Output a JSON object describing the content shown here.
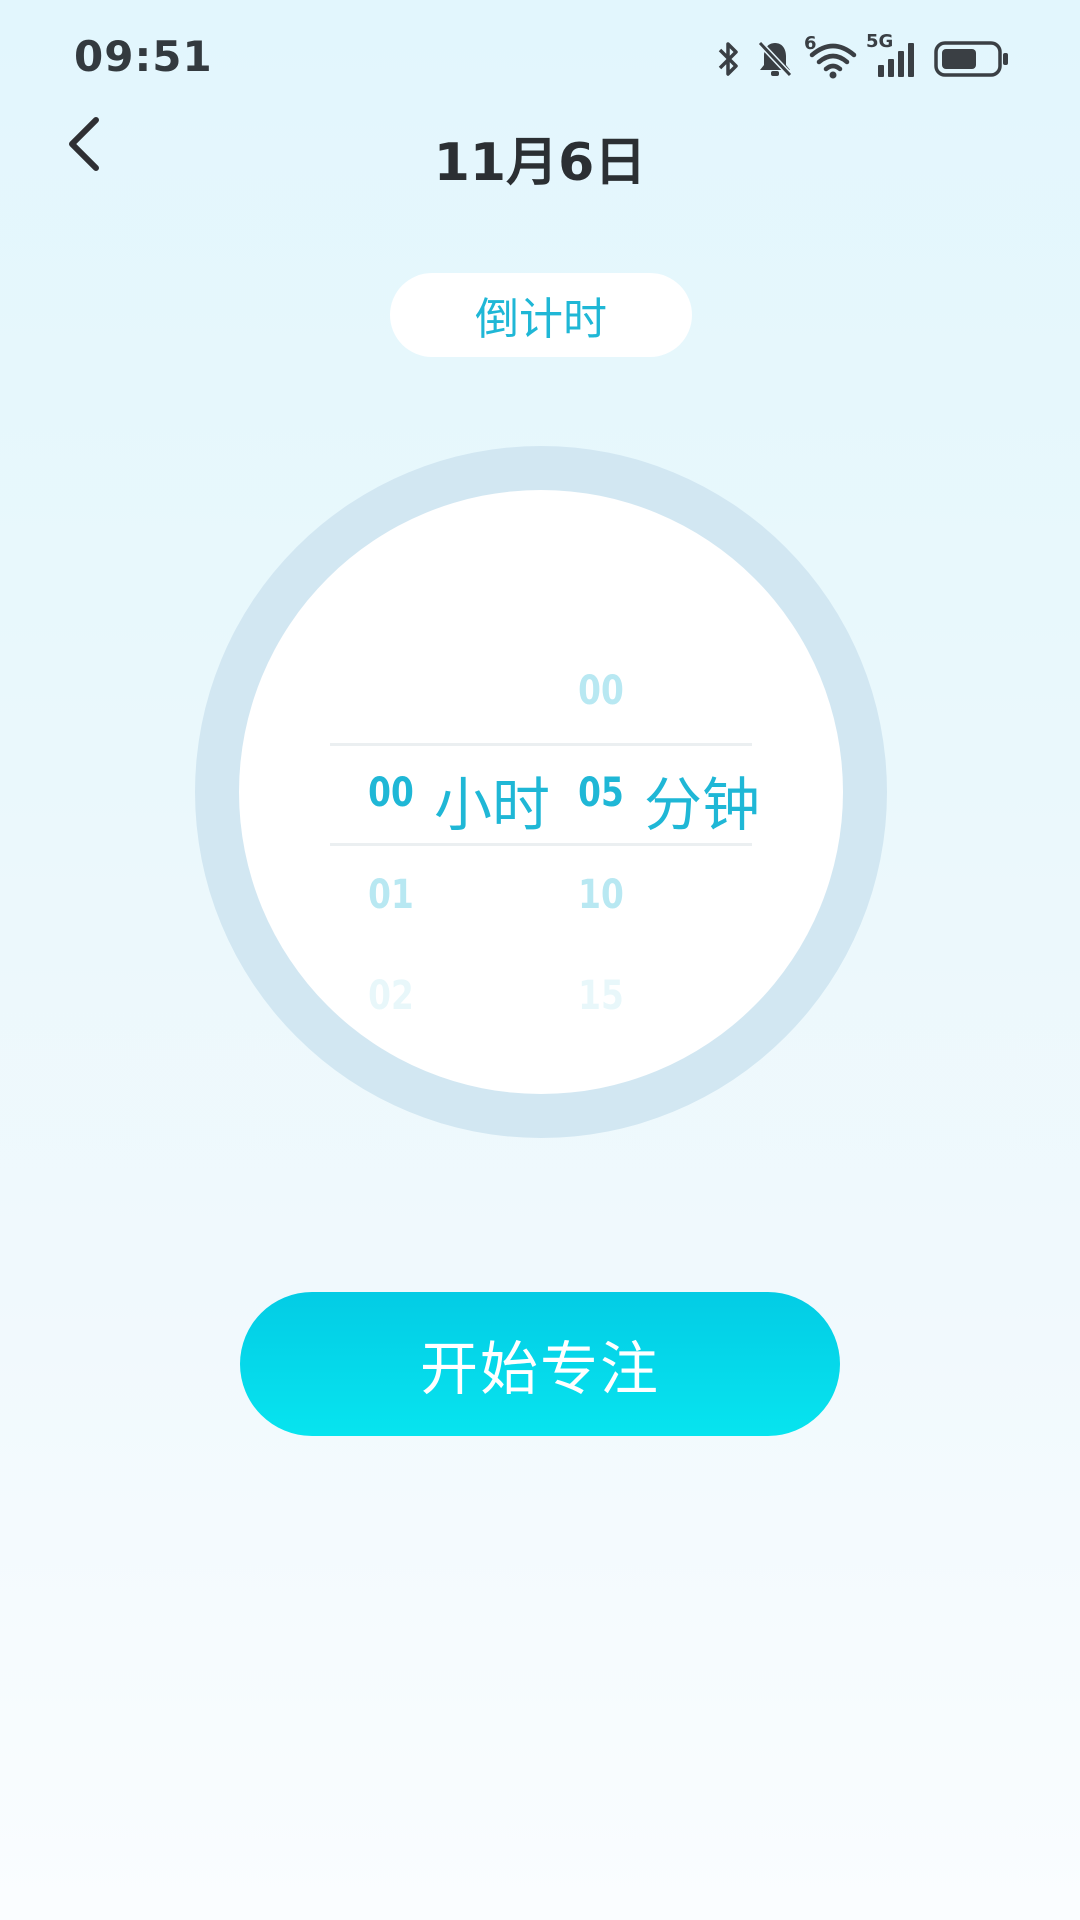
{
  "status_bar": {
    "time": "09:51",
    "network_label": "5G",
    "wifi_label": "6",
    "icons": [
      "bluetooth-icon",
      "bell-muted-icon",
      "wifi-icon",
      "cellular-signal-icon",
      "battery-icon"
    ],
    "battery_level": 0.65
  },
  "header": {
    "back_icon": "chevron-left-icon",
    "title": "11月6日"
  },
  "mode": {
    "label": "倒计时"
  },
  "picker": {
    "hours": {
      "selected": "00",
      "below": [
        "01",
        "02"
      ],
      "unit": "小时"
    },
    "minutes": {
      "above": "00",
      "selected": "05",
      "below": [
        "10",
        "15"
      ],
      "unit": "分钟"
    }
  },
  "start_button": {
    "label": "开始专注"
  },
  "colors": {
    "accent": "#1fb7d6",
    "button_top": "#03cce5",
    "button_bottom": "#07e4ef",
    "ring": "#d2e7f2",
    "title_text": "#2b2f33"
  }
}
